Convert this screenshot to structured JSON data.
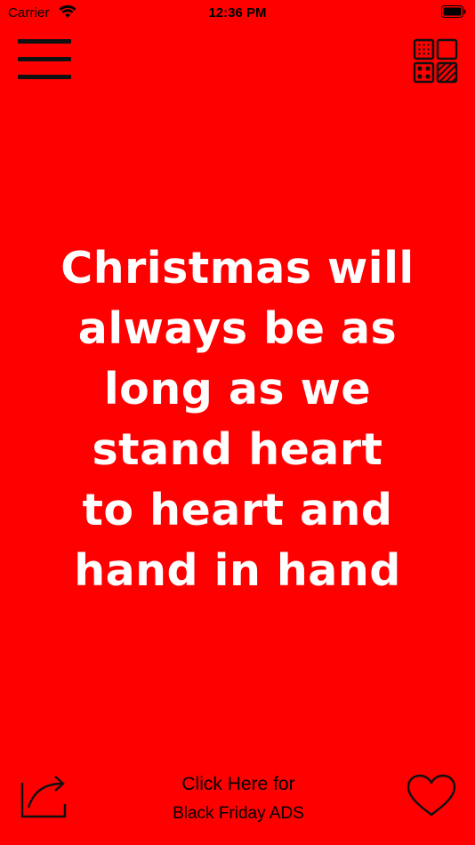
{
  "status_bar": {
    "carrier": "Carrier",
    "time": "12:36 PM"
  },
  "quote": {
    "lines": [
      "Christmas will",
      "always be as",
      "long as we",
      "stand heart",
      "to heart and",
      "hand in hand"
    ]
  },
  "bottom_bar": {
    "ads_line1": "Click Here for",
    "ads_line2": "Black Friday ADS"
  },
  "icons": {
    "menu": "hamburger-menu-icon",
    "grid": "pattern-grid-icon",
    "share": "share-icon",
    "favorite": "heart-icon"
  },
  "colors": {
    "background": "#FF0000",
    "quote_text": "#FFFFFF",
    "icon": "#111111"
  }
}
